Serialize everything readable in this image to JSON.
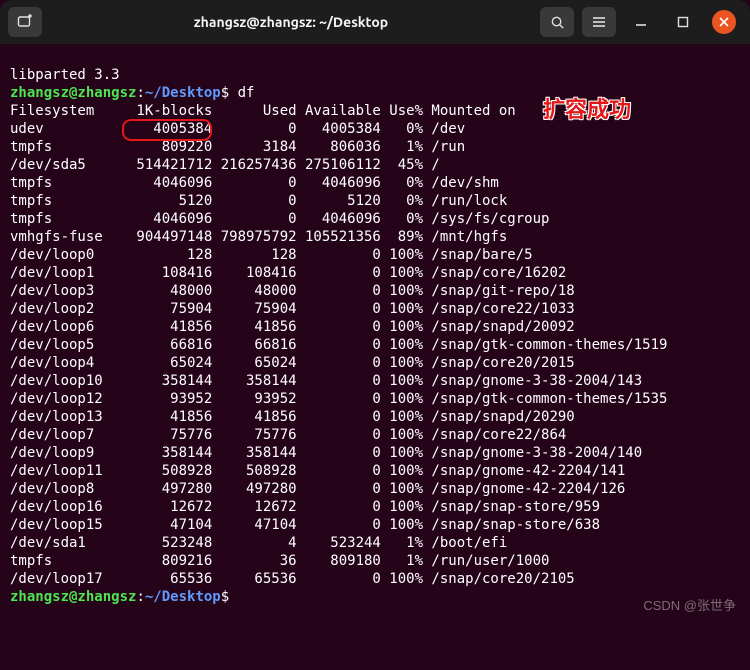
{
  "titlebar": {
    "title": "zhangsz@zhangsz: ~/Desktop"
  },
  "lib_line": "libparted 3.3",
  "prompt": {
    "userhost": "zhangsz@zhangsz",
    "colon": ":",
    "path": "~/Desktop",
    "dollar": "$"
  },
  "command": "df",
  "header": {
    "fs": "Filesystem",
    "blocks": "1K-blocks",
    "used": "Used",
    "avail": "Available",
    "usep": "Use%",
    "mount": "Mounted on"
  },
  "rows": [
    {
      "fs": "udev",
      "blocks": "4005384",
      "used": "0",
      "avail": "4005384",
      "usep": "0%",
      "mount": "/dev"
    },
    {
      "fs": "tmpfs",
      "blocks": "809220",
      "used": "3184",
      "avail": "806036",
      "usep": "1%",
      "mount": "/run"
    },
    {
      "fs": "/dev/sda5",
      "blocks": "514421712",
      "used": "216257436",
      "avail": "275106112",
      "usep": "45%",
      "mount": "/"
    },
    {
      "fs": "tmpfs",
      "blocks": "4046096",
      "used": "0",
      "avail": "4046096",
      "usep": "0%",
      "mount": "/dev/shm"
    },
    {
      "fs": "tmpfs",
      "blocks": "5120",
      "used": "0",
      "avail": "5120",
      "usep": "0%",
      "mount": "/run/lock"
    },
    {
      "fs": "tmpfs",
      "blocks": "4046096",
      "used": "0",
      "avail": "4046096",
      "usep": "0%",
      "mount": "/sys/fs/cgroup"
    },
    {
      "fs": "vmhgfs-fuse",
      "blocks": "904497148",
      "used": "798975792",
      "avail": "105521356",
      "usep": "89%",
      "mount": "/mnt/hgfs"
    },
    {
      "fs": "/dev/loop0",
      "blocks": "128",
      "used": "128",
      "avail": "0",
      "usep": "100%",
      "mount": "/snap/bare/5"
    },
    {
      "fs": "/dev/loop1",
      "blocks": "108416",
      "used": "108416",
      "avail": "0",
      "usep": "100%",
      "mount": "/snap/core/16202"
    },
    {
      "fs": "/dev/loop3",
      "blocks": "48000",
      "used": "48000",
      "avail": "0",
      "usep": "100%",
      "mount": "/snap/git-repo/18"
    },
    {
      "fs": "/dev/loop2",
      "blocks": "75904",
      "used": "75904",
      "avail": "0",
      "usep": "100%",
      "mount": "/snap/core22/1033"
    },
    {
      "fs": "/dev/loop6",
      "blocks": "41856",
      "used": "41856",
      "avail": "0",
      "usep": "100%",
      "mount": "/snap/snapd/20092"
    },
    {
      "fs": "/dev/loop5",
      "blocks": "66816",
      "used": "66816",
      "avail": "0",
      "usep": "100%",
      "mount": "/snap/gtk-common-themes/1519"
    },
    {
      "fs": "/dev/loop4",
      "blocks": "65024",
      "used": "65024",
      "avail": "0",
      "usep": "100%",
      "mount": "/snap/core20/2015"
    },
    {
      "fs": "/dev/loop10",
      "blocks": "358144",
      "used": "358144",
      "avail": "0",
      "usep": "100%",
      "mount": "/snap/gnome-3-38-2004/143"
    },
    {
      "fs": "/dev/loop12",
      "blocks": "93952",
      "used": "93952",
      "avail": "0",
      "usep": "100%",
      "mount": "/snap/gtk-common-themes/1535"
    },
    {
      "fs": "/dev/loop13",
      "blocks": "41856",
      "used": "41856",
      "avail": "0",
      "usep": "100%",
      "mount": "/snap/snapd/20290"
    },
    {
      "fs": "/dev/loop7",
      "blocks": "75776",
      "used": "75776",
      "avail": "0",
      "usep": "100%",
      "mount": "/snap/core22/864"
    },
    {
      "fs": "/dev/loop9",
      "blocks": "358144",
      "used": "358144",
      "avail": "0",
      "usep": "100%",
      "mount": "/snap/gnome-3-38-2004/140"
    },
    {
      "fs": "/dev/loop11",
      "blocks": "508928",
      "used": "508928",
      "avail": "0",
      "usep": "100%",
      "mount": "/snap/gnome-42-2204/141"
    },
    {
      "fs": "/dev/loop8",
      "blocks": "497280",
      "used": "497280",
      "avail": "0",
      "usep": "100%",
      "mount": "/snap/gnome-42-2204/126"
    },
    {
      "fs": "/dev/loop16",
      "blocks": "12672",
      "used": "12672",
      "avail": "0",
      "usep": "100%",
      "mount": "/snap/snap-store/959"
    },
    {
      "fs": "/dev/loop15",
      "blocks": "47104",
      "used": "47104",
      "avail": "0",
      "usep": "100%",
      "mount": "/snap/snap-store/638"
    },
    {
      "fs": "/dev/sda1",
      "blocks": "523248",
      "used": "4",
      "avail": "523244",
      "usep": "1%",
      "mount": "/boot/efi"
    },
    {
      "fs": "tmpfs",
      "blocks": "809216",
      "used": "36",
      "avail": "809180",
      "usep": "1%",
      "mount": "/run/user/1000"
    },
    {
      "fs": "/dev/loop17",
      "blocks": "65536",
      "used": "65536",
      "avail": "0",
      "usep": "100%",
      "mount": "/snap/core20/2105"
    }
  ],
  "callout": "扩容成功",
  "watermark": "CSDN @张世争"
}
